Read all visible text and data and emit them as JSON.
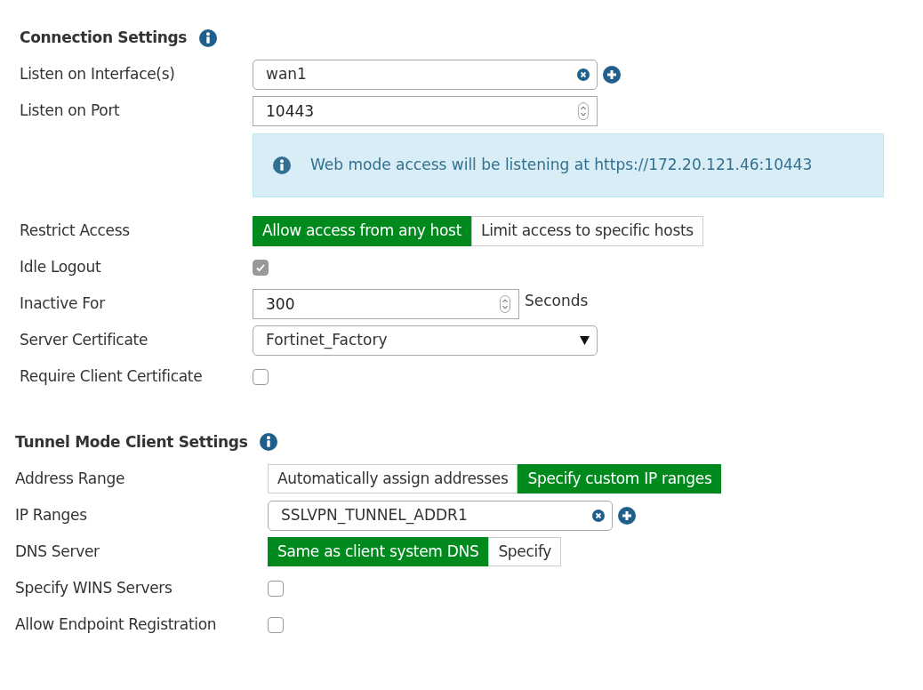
{
  "sections": [
    {
      "title": "Connection Settings",
      "rows": [
        {
          "kind": "tag_field",
          "label": "Listen on Interface(s)",
          "value": "wan1"
        },
        {
          "kind": "number_field",
          "label": "Listen on Port",
          "value": "10443"
        },
        {
          "kind": "info",
          "text": "Web mode access will be listening at https://172.20.121.46:10443"
        },
        {
          "kind": "toggle",
          "label": "Restrict Access",
          "options": [
            {
              "label": "Allow access from any host",
              "selected": true
            },
            {
              "label": "Limit access to specific hosts",
              "selected": false
            }
          ]
        },
        {
          "kind": "checkbox",
          "label": "Idle Logout",
          "checked": true,
          "disabled": true
        },
        {
          "kind": "number_field",
          "label": "Inactive For",
          "value": "300",
          "unit": "Seconds"
        },
        {
          "kind": "select",
          "label": "Server Certificate",
          "value": "Fortinet_Factory"
        },
        {
          "kind": "checkbox",
          "label": "Require Client Certificate",
          "checked": false,
          "disabled": false
        }
      ]
    },
    {
      "title": "Tunnel Mode Client Settings",
      "rows": [
        {
          "kind": "toggle",
          "label": "Address Range",
          "options": [
            {
              "label": "Automatically assign addresses",
              "selected": false
            },
            {
              "label": "Specify custom IP ranges",
              "selected": true
            }
          ]
        },
        {
          "kind": "tag_field",
          "label": "IP Ranges",
          "value": "SSLVPN_TUNNEL_ADDR1"
        },
        {
          "kind": "toggle",
          "label": "DNS Server",
          "options": [
            {
              "label": "Same as client system DNS",
              "selected": true
            },
            {
              "label": "Specify",
              "selected": false
            }
          ]
        },
        {
          "kind": "checkbox",
          "label": "Specify WINS Servers",
          "checked": false,
          "disabled": false
        },
        {
          "kind": "checkbox",
          "label": "Allow Endpoint Registration",
          "checked": false,
          "disabled": false
        }
      ]
    }
  ]
}
